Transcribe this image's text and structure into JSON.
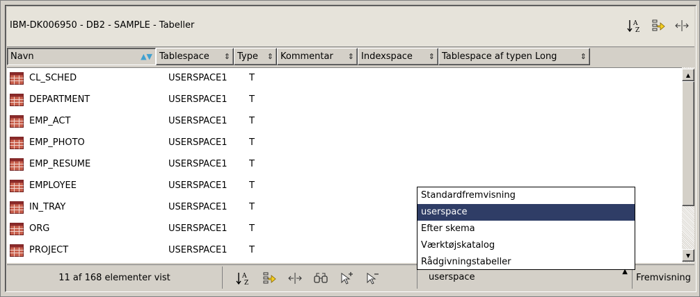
{
  "window": {
    "title": "IBM-DK006950 - DB2 - SAMPLE - Tabeller"
  },
  "title_icons": [
    "sort-az-icon",
    "filter-icon",
    "columns-icon"
  ],
  "columns": [
    {
      "label": "Navn",
      "sort": "▲▼",
      "active": true
    },
    {
      "label": "Tablespace",
      "sort": "⇕"
    },
    {
      "label": "Type",
      "sort": "⇕"
    },
    {
      "label": "Kommentar",
      "sort": "⇕"
    },
    {
      "label": "Indexspace",
      "sort": "⇕"
    },
    {
      "label": "Tablespace af typen Long",
      "sort": "⇕"
    }
  ],
  "rows": [
    {
      "name": "CL_SCHED",
      "tablespace": "USERSPACE1",
      "type": "T"
    },
    {
      "name": "DEPARTMENT",
      "tablespace": "USERSPACE1",
      "type": "T"
    },
    {
      "name": "EMP_ACT",
      "tablespace": "USERSPACE1",
      "type": "T"
    },
    {
      "name": "EMP_PHOTO",
      "tablespace": "USERSPACE1",
      "type": "T"
    },
    {
      "name": "EMP_RESUME",
      "tablespace": "USERSPACE1",
      "type": "T"
    },
    {
      "name": "EMPLOYEE",
      "tablespace": "USERSPACE1",
      "type": "T"
    },
    {
      "name": "IN_TRAY",
      "tablespace": "USERSPACE1",
      "type": "T"
    },
    {
      "name": "ORG",
      "tablespace": "USERSPACE1",
      "type": "T"
    },
    {
      "name": "PROJECT",
      "tablespace": "USERSPACE1",
      "type": "T"
    }
  ],
  "view_menu": {
    "items": [
      "Standardfremvisning",
      "userspace",
      "Efter skema",
      "Værktøjskatalog",
      "Rådgivningstabeller"
    ],
    "selected": "userspace"
  },
  "status": {
    "count_text": "11 af 168 elementer vist"
  },
  "bottom_icons": [
    "sort-az-icon",
    "filter-icon",
    "columns-icon",
    "find-icon",
    "select-add-icon",
    "select-remove-icon"
  ],
  "view_combo": {
    "value": "userspace",
    "button_label": "Fremvisning"
  },
  "colors": {
    "selection": "#2f3d66",
    "panel": "#d4d0c8",
    "table_icon": "#8b2a2a"
  }
}
